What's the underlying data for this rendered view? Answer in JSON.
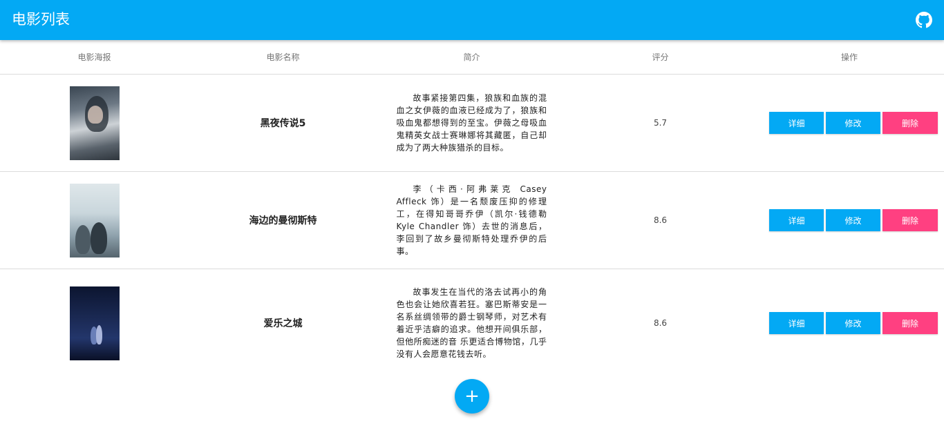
{
  "appbar": {
    "title": "电影列表",
    "github_icon": "github-icon"
  },
  "table": {
    "headers": [
      "电影海报",
      "电影名称",
      "简介",
      "评分",
      "操作"
    ],
    "rows": [
      {
        "name": "黑夜传说5",
        "description": "故事紧接第四集，狼族和血族的混血之女伊薇的血液已经成为了，狼族和吸血鬼都想得到的至宝。伊薇之母吸血鬼精英女战士赛琳娜将其藏匿，自己却成为了两大种族猎杀的目标。",
        "score": "5.7"
      },
      {
        "name": "海边的曼彻斯特",
        "description": "李（卡西·阿弗莱克 Casey Affleck 饰）是一名颓废压抑的修理工，在得知哥哥乔伊（凯尔·钱德勒 Kyle Chandler 饰）去世的消息后，李回到了故乡曼彻斯特处理乔伊的后事。",
        "score": "8.6"
      },
      {
        "name": "爱乐之城",
        "description": "故事发生在当代的洛去试再小的角色也会让她欣喜若狂。塞巴斯蒂安是一名系丝绸领带的爵士钢琴师，对艺术有着近乎洁癖的追求。他想开间俱乐部，但他所痴迷的音 乐更适合博物馆，几乎没有人会愿意花钱去听。",
        "score": "8.6"
      }
    ]
  },
  "actions": {
    "detail": "详细",
    "edit": "修改",
    "delete": "删除"
  },
  "fab": {
    "label": "+"
  },
  "colors": {
    "primary": "#03a9f4",
    "accent": "#ff4081"
  }
}
